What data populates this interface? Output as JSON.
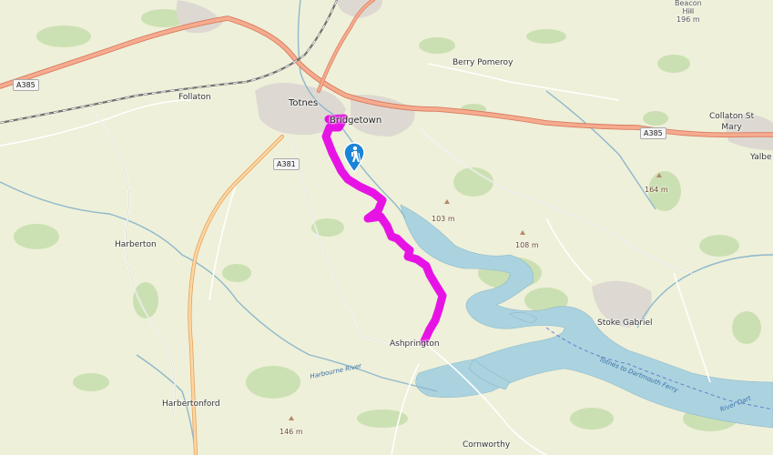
{
  "map": {
    "places": {
      "totnes": "Totnes",
      "bridgetown": "Bridgetown",
      "berry_pomeroy": "Berry Pomeroy",
      "follaton": "Follaton",
      "collaton": "Collaton St\nMary",
      "yalberton": "Yalbe",
      "harberton": "Harberton",
      "harbertonford": "Harbertonford",
      "ashprington": "Ashprington",
      "stoke_gabriel": "Stoke Gabriel",
      "cornworthy": "Cornworthy",
      "beacon": "Beacon\nHill\n196 m"
    },
    "heights": {
      "h103": "103 m",
      "h108": "108 m",
      "h164": "164 m",
      "h146": "146 m"
    },
    "roads": {
      "a385_west": "A385",
      "a385_east": "A385",
      "a381": "A381"
    },
    "water_labels": {
      "harbourne": "Harbourne River",
      "ferry": "Totnes to Dartmouth Ferry",
      "river_dart": "River Dart"
    },
    "route_color": "#e600e6",
    "poi_icon": "hiker-marker-icon"
  }
}
